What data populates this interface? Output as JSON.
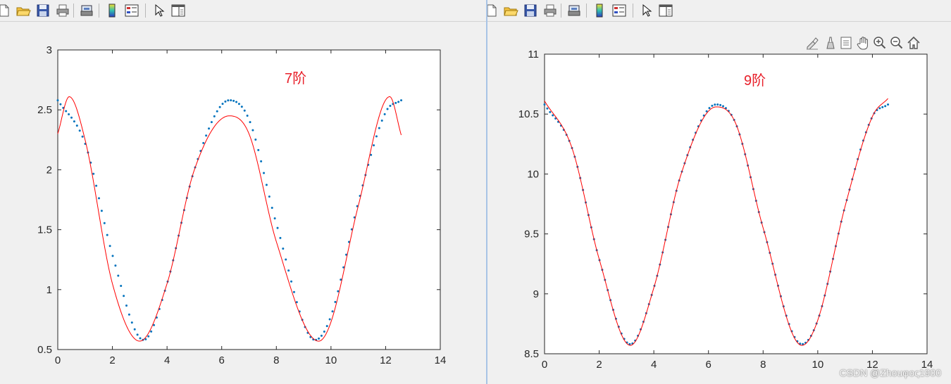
{
  "windows": [
    {
      "id": "left",
      "annotation": "7阶",
      "annotation_color": "#e8202a",
      "toolbar_icons": [
        "new-file-icon",
        "open-folder-icon",
        "save-icon",
        "print-icon",
        "print-preview-icon",
        "colorbar-icon",
        "legend-icon",
        "edit-plot-icon",
        "property-inspector-icon"
      ]
    },
    {
      "id": "right",
      "annotation": "9阶",
      "annotation_color": "#e8202a",
      "toolbar_icons": [
        "new-file-icon",
        "open-folder-icon",
        "save-icon",
        "print-icon",
        "print-preview-icon",
        "colorbar-icon",
        "legend-icon",
        "edit-plot-icon",
        "property-inspector-icon"
      ],
      "axes_toolbar_icons": [
        "brush-icon",
        "data-cursor-icon",
        "link-data-icon",
        "pan-icon",
        "zoom-in-icon",
        "zoom-out-icon",
        "home-icon"
      ]
    }
  ],
  "colors": {
    "dots": "#0072bd",
    "fit_line": "#ff0000",
    "axes_bg": "#ffffff",
    "figure_bg": "#f0f0f0"
  },
  "chart_data": [
    {
      "type": "line",
      "title": "",
      "xlabel": "",
      "ylabel": "",
      "annotation": "7阶",
      "xlim": [
        0,
        14
      ],
      "ylim": [
        0.5,
        3
      ],
      "xticks": [
        0,
        2,
        4,
        6,
        8,
        10,
        12,
        14
      ],
      "yticks": [
        "0.5",
        "1",
        "1.5",
        "2",
        "2.5",
        "3"
      ],
      "x_range": [
        0,
        12.57
      ],
      "series": [
        {
          "style": "dots",
          "n_points": 126,
          "x": [
            0.0,
            1.0,
            2.0,
            3.14,
            4.0,
            5.0,
            6.28,
            7.0,
            8.0,
            9.42,
            10.0,
            11.0,
            12.0,
            12.57
          ],
          "y": [
            2.58,
            2.22,
            1.29,
            0.58,
            1.05,
            2.0,
            2.58,
            2.42,
            1.55,
            0.58,
            0.78,
            1.73,
            2.48,
            2.58
          ]
        },
        {
          "style": "line",
          "x": [
            0.0,
            0.42,
            1.0,
            2.0,
            3.0,
            4.0,
            5.0,
            6.28,
            7.0,
            8.0,
            9.55,
            10.0,
            11.0,
            12.15,
            12.57
          ],
          "y": [
            2.3,
            2.61,
            2.25,
            1.05,
            0.57,
            1.05,
            2.0,
            2.45,
            2.3,
            1.4,
            0.57,
            0.73,
            1.7,
            2.61,
            2.29
          ]
        }
      ]
    },
    {
      "type": "line",
      "title": "",
      "xlabel": "",
      "ylabel": "",
      "annotation": "9阶",
      "xlim": [
        0,
        14
      ],
      "ylim": [
        8.5,
        11
      ],
      "xticks": [
        0,
        2,
        4,
        6,
        8,
        10,
        12,
        14
      ],
      "yticks": [
        "8.5",
        "9",
        "9.5",
        "10",
        "10.5",
        "11"
      ],
      "x_range": [
        0,
        12.57
      ],
      "series": [
        {
          "style": "dots",
          "n_points": 126,
          "x": [
            0.0,
            1.0,
            2.0,
            3.14,
            4.0,
            5.0,
            6.28,
            7.0,
            8.0,
            9.42,
            10.0,
            11.0,
            12.0,
            12.57
          ],
          "y": [
            10.58,
            10.22,
            9.29,
            8.58,
            9.05,
            10.0,
            10.58,
            10.42,
            9.55,
            8.58,
            8.78,
            9.73,
            10.48,
            10.58
          ]
        },
        {
          "style": "line",
          "x": [
            0.0,
            1.0,
            2.0,
            3.14,
            4.0,
            5.0,
            6.28,
            7.0,
            8.0,
            9.42,
            10.0,
            11.0,
            12.0,
            12.57
          ],
          "y": [
            10.61,
            10.22,
            9.29,
            8.57,
            9.05,
            10.0,
            10.56,
            10.42,
            9.55,
            8.57,
            8.78,
            9.73,
            10.48,
            10.63
          ]
        }
      ]
    }
  ],
  "watermark": "CSDN @Zhouφος1900"
}
